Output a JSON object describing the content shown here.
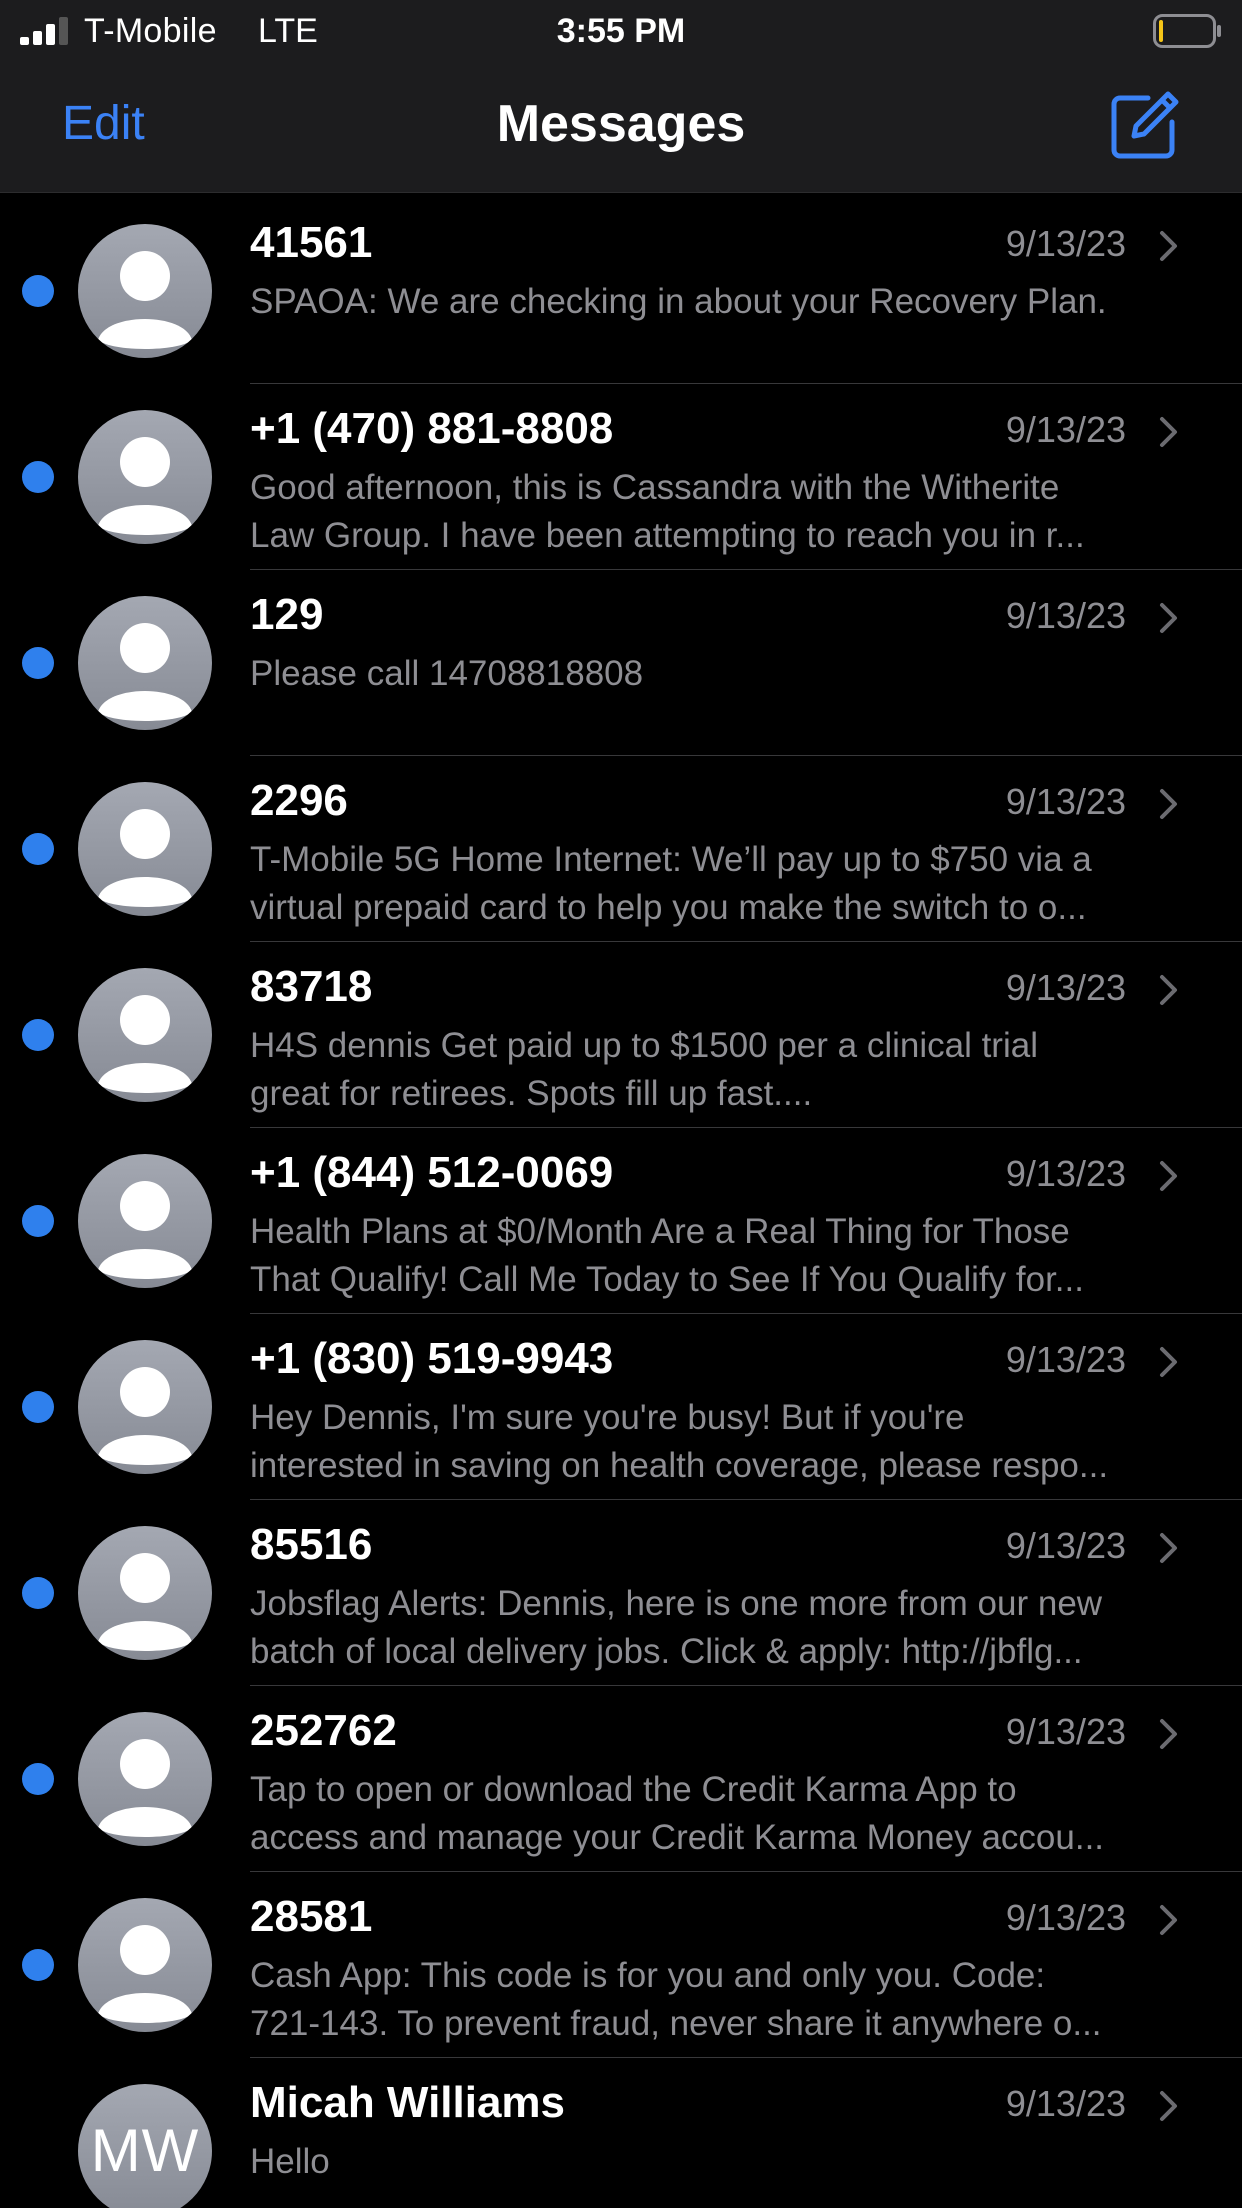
{
  "status_bar": {
    "carrier": "T-Mobile",
    "network": "LTE",
    "time": "3:55 PM",
    "signal_bars": 3,
    "battery_level": 0.08,
    "battery_color": "#f5c518"
  },
  "nav": {
    "edit_label": "Edit",
    "title": "Messages",
    "compose_icon": "compose-icon"
  },
  "colors": {
    "accent": "#3b82f6",
    "unread_dot": "#2f80ed",
    "secondary_text": "#8e8e93",
    "background": "#000000"
  },
  "conversations": [
    {
      "sender": "41561",
      "date": "9/13/23",
      "unread": true,
      "preview_lines": [
        "SPAOA: We are checking in about your Recovery Plan."
      ]
    },
    {
      "sender": "+1 (470) 881-8808",
      "date": "9/13/23",
      "unread": true,
      "preview_lines": [
        "Good afternoon, this is Cassandra with the Witherite",
        "Law Group.  I have been attempting to reach you in r..."
      ]
    },
    {
      "sender": "129",
      "date": "9/13/23",
      "unread": true,
      "preview_lines": [
        "Please call 14708818808"
      ]
    },
    {
      "sender": "2296",
      "date": "9/13/23",
      "unread": true,
      "preview_lines": [
        "T-Mobile 5G Home Internet: We’ll pay up to $750 via a",
        "virtual prepaid card to help you make the switch to o..."
      ]
    },
    {
      "sender": "83718",
      "date": "9/13/23",
      "unread": true,
      "preview_lines": [
        "H4S dennis Get paid up to $1500 per a clinical trial",
        "great for retirees. Spots fill up fast...."
      ]
    },
    {
      "sender": "+1 (844) 512-0069",
      "date": "9/13/23",
      "unread": true,
      "preview_lines": [
        "Health Plans at $0/Month Are a Real Thing for Those",
        "That Qualify! Call Me Today to See If You Qualify for..."
      ]
    },
    {
      "sender": "+1 (830) 519-9943",
      "date": "9/13/23",
      "unread": true,
      "preview_lines": [
        "Hey Dennis, I'm sure you're busy! But if you're",
        "interested in saving on health coverage, please respo..."
      ]
    },
    {
      "sender": "85516",
      "date": "9/13/23",
      "unread": true,
      "preview_lines": [
        "Jobsflag Alerts: Dennis, here is one more from our new",
        "batch of local delivery jobs. Click & apply: http://jbflg..."
      ]
    },
    {
      "sender": "252762",
      "date": "9/13/23",
      "unread": true,
      "preview_lines": [
        "Tap to open or download the Credit Karma App to",
        "access and manage your Credit Karma Money accou..."
      ]
    },
    {
      "sender": "28581",
      "date": "9/13/23",
      "unread": true,
      "preview_lines": [
        "Cash App: This code is for you and only you. Code:",
        "721-143. To prevent fraud, never share it anywhere o..."
      ]
    },
    {
      "sender": "Micah Williams",
      "date": "9/13/23",
      "unread": false,
      "initials": "MW",
      "preview_lines": [
        "Hello"
      ]
    }
  ]
}
